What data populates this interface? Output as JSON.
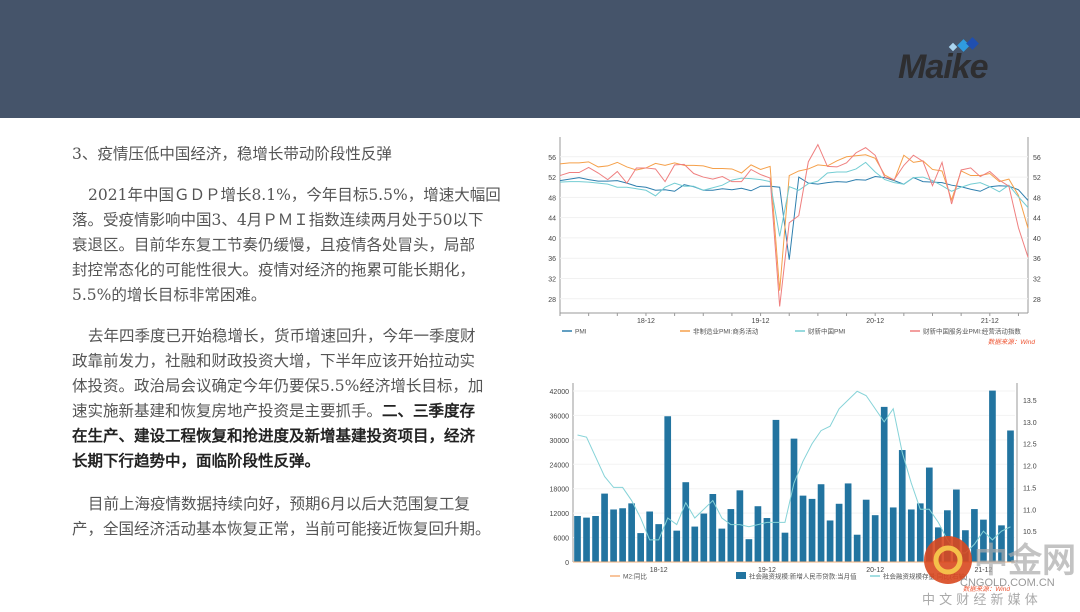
{
  "header": {
    "logo_text": "Maike"
  },
  "article": {
    "title": "3、疫情压低中国经济，稳增长带动阶段性反弹",
    "p1": [
      "2021年中国ＧＤＰ增长8.1%，今年目标5.5%，增速大幅回",
      "落。受疫情影响中国3、4月ＰＭＩ指数连续两月处于50以下",
      "衰退区。目前华东复工节奏仍缓慢，且疫情各处冒头，局部",
      "封控常态化的可能性很大。疫情对经济的拖累可能长期化，",
      "5.5%的增长目标非常困难。"
    ],
    "p2": [
      [
        {
          "t": "去年四季度已开始稳增长，货币增速回升，今年一季度财",
          "b": false
        }
      ],
      [
        {
          "t": "政靠前发力，社融和财政投资大增，下半年应该开始拉动实",
          "b": false
        }
      ],
      [
        {
          "t": "体投资。政治局会议确定今年仍要保5.5%经济增长目标，加",
          "b": false
        }
      ],
      [
        {
          "t": "速实施新基建和恢复房地产投资是主要抓手。",
          "b": false
        },
        {
          "t": "二、三季度存",
          "b": true
        }
      ],
      [
        {
          "t": "在生产、建设工程恢复和抢进度及新增基建投资项目，经济",
          "b": true
        }
      ],
      [
        {
          "t": "长期下行趋势中，面临阶段性反弹。",
          "b": true
        }
      ]
    ],
    "p3": [
      "目前上海疫情数据持续向好，预期6月以后大范围复工复",
      "产，全国经济活动基本恢复正常，当前可能接近恢复回升期。"
    ]
  },
  "chart_data": [
    {
      "type": "line",
      "title": "",
      "ylabel": "%",
      "ylim": [
        25.2,
        59.9
      ],
      "yticks": [
        "28",
        "32",
        "36",
        "40",
        "44",
        "48",
        "52",
        "56"
      ],
      "xticks": [
        {
          "label": "18-12",
          "index": 9
        },
        {
          "label": "19-12",
          "index": 21
        },
        {
          "label": "20-12",
          "index": 33
        },
        {
          "label": "21-12",
          "index": 45
        }
      ],
      "series": [
        {
          "name": "PMI",
          "color": "#2e7fae",
          "values": [
            51.3,
            51.6,
            51.9,
            51.5,
            51.2,
            51.2,
            51.3,
            50.8,
            50.2,
            50.0,
            49.4,
            49.5,
            49.2,
            50.5,
            50.1,
            49.4,
            49.4,
            49.7,
            49.5,
            49.8,
            49.3,
            50.2,
            50.2,
            50.0,
            35.7,
            52.0,
            50.8,
            50.6,
            50.9,
            51.1,
            51.0,
            51.5,
            51.4,
            52.1,
            51.9,
            51.3,
            50.6,
            51.9,
            51.1,
            51.0,
            50.9,
            50.4,
            50.1,
            49.6,
            49.2,
            50.1,
            50.3,
            50.2,
            49.5,
            47.4
          ]
        },
        {
          "name": "非制造业PMI:商务活动",
          "color": "#f5a04a",
          "values": [
            54.6,
            54.8,
            54.8,
            55.0,
            54.0,
            54.2,
            54.9,
            54.0,
            53.4,
            53.8,
            54.7,
            54.3,
            54.8,
            54.3,
            54.3,
            54.2,
            53.7,
            53.7,
            53.6,
            52.8,
            54.4,
            53.5,
            54.1,
            29.6,
            52.3,
            53.2,
            53.6,
            54.4,
            54.2,
            55.2,
            56.0,
            56.2,
            56.4,
            55.7,
            52.4,
            51.4,
            56.3,
            54.9,
            55.2,
            53.5,
            53.2,
            47.5,
            53.2,
            52.3,
            52.3,
            52.7,
            51.1,
            51.6,
            48.4,
            41.9
          ]
        },
        {
          "name": "财新中国PMI",
          "color": "#74cdd3",
          "values": [
            51.0,
            51.1,
            51.1,
            51.0,
            50.8,
            50.6,
            50.0,
            50.0,
            49.7,
            49.4,
            48.3,
            50.0,
            50.8,
            50.2,
            50.2,
            49.4,
            49.9,
            50.4,
            51.4,
            51.8,
            51.7,
            51.5,
            51.1,
            40.3,
            50.1,
            49.4,
            50.7,
            51.2,
            52.8,
            53.0,
            53.0,
            53.6,
            54.9,
            53.0,
            51.5,
            50.9,
            50.6,
            51.9,
            52.0,
            51.3,
            50.3,
            49.2,
            50.0,
            50.6,
            50.9,
            50.1,
            49.1,
            50.4,
            48.1,
            46.0
          ]
        },
        {
          "name": "财新中国服务业PMI:经营活动指数",
          "color": "#ef7f7f",
          "values": [
            52.3,
            52.9,
            52.9,
            53.9,
            52.8,
            51.5,
            53.1,
            50.8,
            53.8,
            53.8,
            53.6,
            51.1,
            54.4,
            54.5,
            52.7,
            52.0,
            51.6,
            52.1,
            51.1,
            51.1,
            53.5,
            52.5,
            51.8,
            26.5,
            43.0,
            44.4,
            55.0,
            58.4,
            54.1,
            54.0,
            54.8,
            56.8,
            57.8,
            56.3,
            52.0,
            51.5,
            54.3,
            56.3,
            55.1,
            50.3,
            54.9,
            46.7,
            53.4,
            53.8,
            52.1,
            53.1,
            51.4,
            50.2,
            42.0,
            36.2
          ]
        }
      ],
      "source": "数据来源：Wind"
    },
    {
      "type": "bar",
      "title": "",
      "ylim": [
        0,
        42000
      ],
      "y2lim": [
        10.0,
        13.8
      ],
      "yticks": [
        "0",
        "6000",
        "12000",
        "18000",
        "24000",
        "30000",
        "36000",
        "42000"
      ],
      "y2ticks": [
        "10.5",
        "11.0",
        "11.5",
        "12.0",
        "12.5",
        "13.0",
        "13.5"
      ],
      "xticks": [
        {
          "label": "18-12",
          "index": 9
        },
        {
          "label": "19-12",
          "index": 21
        },
        {
          "label": "20-12",
          "index": 33
        },
        {
          "label": "21-12",
          "index": 45
        }
      ],
      "legend": [
        "M2:同比",
        "社会融资规模:新增人民币贷款:当月值",
        "社会融资规模存量:同比(右轴)"
      ],
      "colors": {
        "bar": "#2274a0",
        "line": "#86d3d8",
        "m2": "#f5b07a"
      },
      "bars": [
        11300,
        10900,
        11300,
        16800,
        12900,
        13200,
        14400,
        7100,
        12400,
        9300,
        35800,
        7700,
        19600,
        8700,
        11900,
        16700,
        8200,
        13000,
        17600,
        5600,
        13700,
        10800,
        34900,
        7200,
        30300,
        16300,
        15500,
        19100,
        10200,
        14300,
        19300,
        6700,
        15300,
        11500,
        38100,
        13400,
        27500,
        12900,
        14400,
        23200,
        8500,
        12700,
        17800,
        7800,
        13000,
        10400,
        42100,
        9000,
        32300
      ],
      "line": [
        12.7,
        12.65,
        12.2,
        11.75,
        11.5,
        11.5,
        11.2,
        10.8,
        10.3,
        10.3,
        10.8,
        10.65,
        11.15,
        10.8,
        11.0,
        11.2,
        10.8,
        10.65,
        10.65,
        10.6,
        10.65,
        10.7,
        10.7,
        10.7,
        11.6,
        12.1,
        12.5,
        12.8,
        12.9,
        13.3,
        13.5,
        13.7,
        13.6,
        13.3,
        13.0,
        13.3,
        12.3,
        11.6,
        11.0,
        11.0,
        10.7,
        10.3,
        10.0,
        10.0,
        10.2,
        10.5,
        10.3,
        10.5,
        10.6
      ],
      "source": "数据来源：Wind"
    }
  ],
  "watermark": {
    "brand": "中金网",
    "domain": "CNGOLD.COM.CN",
    "slogan": "中 文 财 经 新 媒 体"
  }
}
